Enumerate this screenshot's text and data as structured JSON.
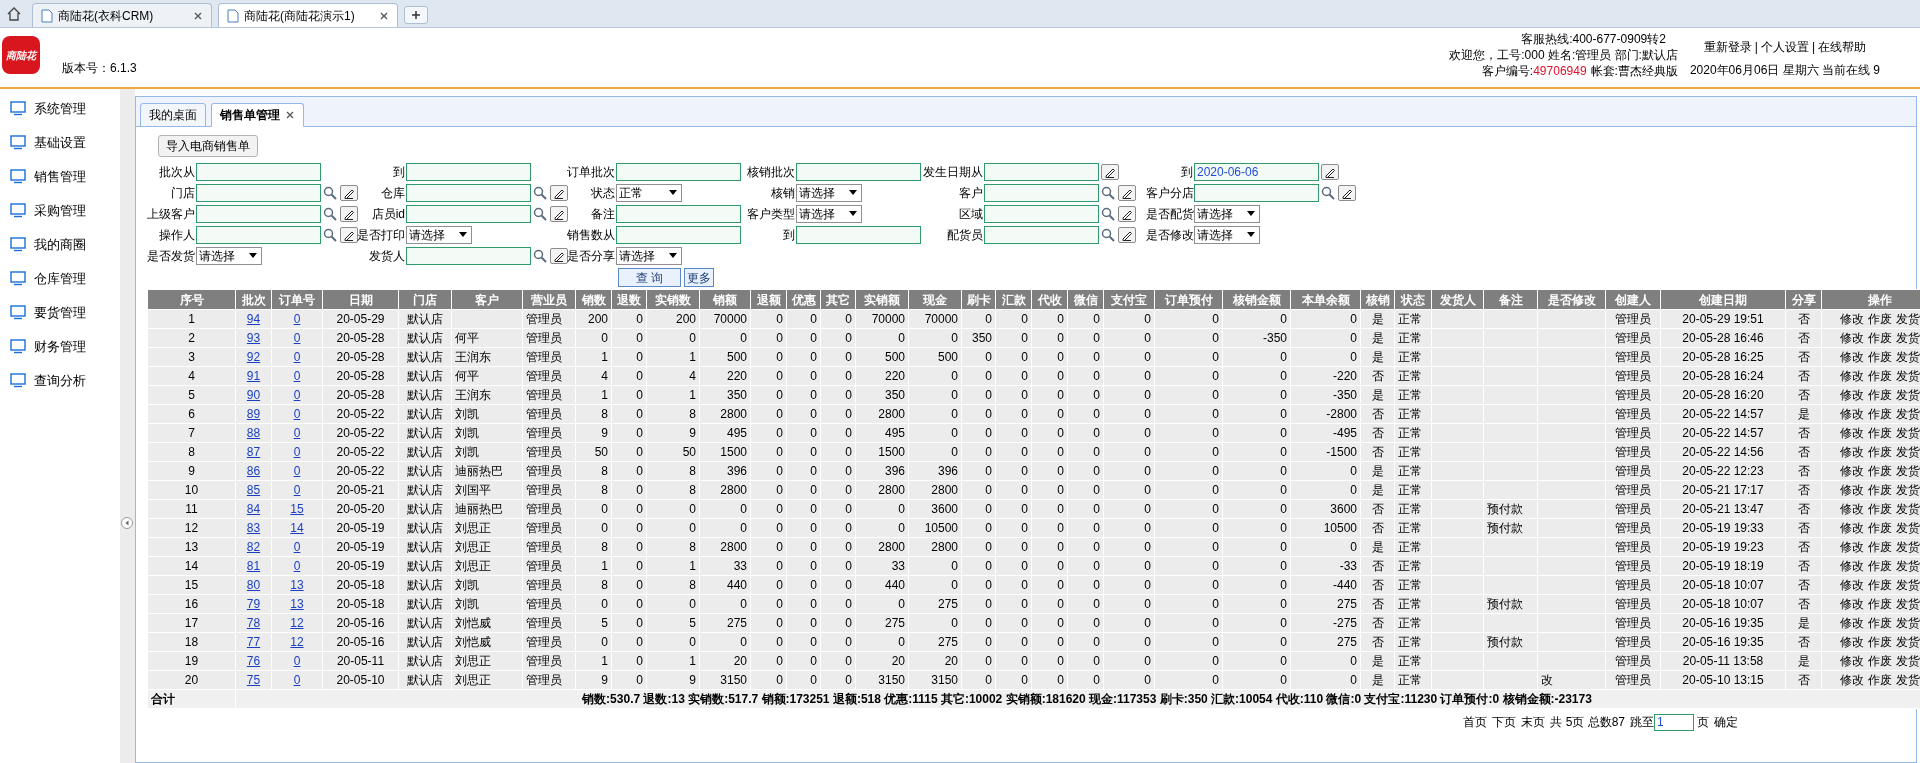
{
  "browser_tabs": [
    {
      "label": "商陆花(衣科CRM)",
      "selected": false
    },
    {
      "label": "商陆花(商陆花演示1)",
      "selected": true
    }
  ],
  "header": {
    "logo_text": "商陆花",
    "version": "版本号：6.1.3",
    "hotline": "客服热线:400-677-0909转2",
    "welcome": "欢迎您，工号:000 姓名:管理员 部门:默认店",
    "customer_label": "客户编号:",
    "customer_id": "49706949",
    "account": "帐套:曹杰经典版",
    "links": [
      "重新登录",
      "个人设置",
      "在线帮助"
    ],
    "link_separator": "|",
    "date_line": "2020年06月06日 星期六 当前在线 9"
  },
  "sidebar": {
    "items": [
      "系统管理",
      "基础设置",
      "销售管理",
      "采购管理",
      "我的商圈",
      "仓库管理",
      "要货管理",
      "财务管理",
      "查询分析"
    ]
  },
  "page_tabs": [
    {
      "label": "我的桌面",
      "selected": false,
      "closable": false
    },
    {
      "label": "销售单管理",
      "selected": true,
      "closable": true
    }
  ],
  "import_button": "导入电商销售单",
  "filters": [
    [
      {
        "label": "批次从",
        "kind": "text"
      },
      {
        "label": "到",
        "kind": "text"
      },
      {
        "label": "订单批次",
        "kind": "text"
      },
      {
        "label": "核销批次",
        "kind": "text"
      },
      {
        "label": "发生日期从",
        "kind": "date"
      },
      {
        "label": "到",
        "kind": "date",
        "value": "2020-06-06"
      }
    ],
    [
      {
        "label": "门店",
        "kind": "lookup"
      },
      {
        "label": "仓库",
        "kind": "lookup"
      },
      {
        "label": "状态",
        "kind": "select",
        "value": "正常"
      },
      {
        "label": "核销",
        "kind": "select",
        "value": "请选择"
      },
      {
        "label": "客户",
        "kind": "lookup"
      },
      {
        "label": "客户分店",
        "kind": "lookup"
      }
    ],
    [
      {
        "label": "上级客户",
        "kind": "lookup"
      },
      {
        "label": "店员id",
        "kind": "lookup"
      },
      {
        "label": "备注",
        "kind": "text"
      },
      {
        "label": "客户类型",
        "kind": "select",
        "value": "请选择"
      },
      {
        "label": "区域",
        "kind": "lookup"
      },
      {
        "label": "是否配货",
        "kind": "select",
        "value": "请选择"
      }
    ],
    [
      {
        "label": "操作人",
        "kind": "lookup"
      },
      {
        "label": "是否打印",
        "kind": "select",
        "value": "请选择"
      },
      {
        "label": "销售数从",
        "kind": "text"
      },
      {
        "label": "到",
        "kind": "text"
      },
      {
        "label": "配货员",
        "kind": "lookup"
      },
      {
        "label": "是否修改",
        "kind": "select",
        "value": "请选择"
      }
    ],
    [
      {
        "label": "是否发货",
        "kind": "select",
        "value": "请选择"
      },
      {
        "label": "发货人",
        "kind": "lookup"
      },
      {
        "label": "是否分享",
        "kind": "select",
        "value": "请选择"
      }
    ]
  ],
  "query_buttons": [
    "查 询",
    "更多"
  ],
  "table": {
    "columns": [
      "序号",
      "批次",
      "订单号",
      "日期",
      "门店",
      "客户",
      "营业员",
      "销数",
      "退数",
      "实销数",
      "销额",
      "退额",
      "优惠",
      "其它",
      "实销额",
      "现金",
      "刷卡",
      "汇款",
      "代收",
      "微信",
      "支付宝",
      "订单预付",
      "核销金额",
      "本单余额",
      "核销",
      "状态",
      "发货人",
      "备注",
      "是否修改",
      "创建人",
      "创建日期",
      "分享",
      "操作"
    ],
    "rows": [
      {
        "cells": [
          "1",
          "94",
          "0",
          "20-05-29",
          "默认店",
          null,
          "管理员",
          "200",
          "0",
          "200",
          "70000",
          "0",
          "0",
          "0",
          "70000",
          "70000",
          "0",
          "0",
          "0",
          "0",
          "0",
          "0",
          "0",
          "0",
          "是",
          "正常",
          null,
          null,
          null,
          "管理员",
          "20-05-29 19:51",
          "否"
        ],
        "actions": [
          "修改",
          "作废",
          "发货"
        ]
      },
      {
        "cells": [
          "2",
          "93",
          "0",
          "20-05-28",
          "默认店",
          "何平",
          "管理员",
          "0",
          "0",
          "0",
          "0",
          "0",
          "0",
          "0",
          "0",
          "0",
          "350",
          "0",
          "0",
          "0",
          "0",
          "0",
          "-350",
          "0",
          "是",
          "正常",
          null,
          null,
          null,
          "管理员",
          "20-05-28 16:46",
          "否"
        ],
        "actions": [
          "修改",
          "作废",
          "发货"
        ]
      },
      {
        "cells": [
          "3",
          "92",
          "0",
          "20-05-28",
          "默认店",
          "王润东",
          "管理员",
          "1",
          "0",
          "1",
          "500",
          "0",
          "0",
          "0",
          "500",
          "500",
          "0",
          "0",
          "0",
          "0",
          "0",
          "0",
          "0",
          "0",
          "是",
          "正常",
          null,
          null,
          null,
          "管理员",
          "20-05-28 16:25",
          "否"
        ],
        "actions": [
          "修改",
          "作废",
          "发货"
        ]
      },
      {
        "cells": [
          "4",
          "91",
          "0",
          "20-05-28",
          "默认店",
          "何平",
          "管理员",
          "4",
          "0",
          "4",
          "220",
          "0",
          "0",
          "0",
          "220",
          "0",
          "0",
          "0",
          "0",
          "0",
          "0",
          "0",
          "0",
          "-220",
          "否",
          "正常",
          null,
          null,
          null,
          "管理员",
          "20-05-28 16:24",
          "否"
        ],
        "actions": [
          "修改",
          "作废",
          "发货"
        ]
      },
      {
        "cells": [
          "5",
          "90",
          "0",
          "20-05-28",
          "默认店",
          "王润东",
          "管理员",
          "1",
          "0",
          "1",
          "350",
          "0",
          "0",
          "0",
          "350",
          "0",
          "0",
          "0",
          "0",
          "0",
          "0",
          "0",
          "0",
          "-350",
          "是",
          "正常",
          null,
          null,
          null,
          "管理员",
          "20-05-28 16:20",
          "否"
        ],
        "actions": [
          "修改",
          "作废",
          "发货"
        ]
      },
      {
        "cells": [
          "6",
          "89",
          "0",
          "20-05-22",
          "默认店",
          "刘凯",
          "管理员",
          "8",
          "0",
          "8",
          "2800",
          "0",
          "0",
          "0",
          "2800",
          "0",
          "0",
          "0",
          "0",
          "0",
          "0",
          "0",
          "0",
          "-2800",
          "否",
          "正常",
          null,
          null,
          null,
          "管理员",
          "20-05-22 14:57",
          "是"
        ],
        "actions": [
          "修改",
          "作废",
          "发货"
        ]
      },
      {
        "cells": [
          "7",
          "88",
          "0",
          "20-05-22",
          "默认店",
          "刘凯",
          "管理员",
          "9",
          "0",
          "9",
          "495",
          "0",
          "0",
          "0",
          "495",
          "0",
          "0",
          "0",
          "0",
          "0",
          "0",
          "0",
          "0",
          "-495",
          "否",
          "正常",
          null,
          null,
          null,
          "管理员",
          "20-05-22 14:57",
          "否"
        ],
        "actions": [
          "修改",
          "作废",
          "发货"
        ]
      },
      {
        "cells": [
          "8",
          "87",
          "0",
          "20-05-22",
          "默认店",
          "刘凯",
          "管理员",
          "50",
          "0",
          "50",
          "1500",
          "0",
          "0",
          "0",
          "1500",
          "0",
          "0",
          "0",
          "0",
          "0",
          "0",
          "0",
          "0",
          "-1500",
          "否",
          "正常",
          null,
          null,
          null,
          "管理员",
          "20-05-22 14:56",
          "否"
        ],
        "actions": [
          "修改",
          "作废",
          "发货"
        ]
      },
      {
        "cells": [
          "9",
          "86",
          "0",
          "20-05-22",
          "默认店",
          "迪丽热巴",
          "管理员",
          "8",
          "0",
          "8",
          "396",
          "0",
          "0",
          "0",
          "396",
          "396",
          "0",
          "0",
          "0",
          "0",
          "0",
          "0",
          "0",
          "0",
          "是",
          "正常",
          null,
          null,
          null,
          "管理员",
          "20-05-22 12:23",
          "否"
        ],
        "actions": [
          "修改",
          "作废",
          "发货"
        ]
      },
      {
        "cells": [
          "10",
          "85",
          "0",
          "20-05-21",
          "默认店",
          "刘国平",
          "管理员",
          "8",
          "0",
          "8",
          "2800",
          "0",
          "0",
          "0",
          "2800",
          "2800",
          "0",
          "0",
          "0",
          "0",
          "0",
          "0",
          "0",
          "0",
          "是",
          "正常",
          null,
          null,
          null,
          "管理员",
          "20-05-21 17:17",
          "否"
        ],
        "actions": [
          "修改",
          "作废",
          "发货"
        ]
      },
      {
        "cells": [
          "11",
          "84",
          "15",
          "20-05-20",
          "默认店",
          "迪丽热巴",
          "管理员",
          "0",
          "0",
          "0",
          "0",
          "0",
          "0",
          "0",
          "0",
          "3600",
          "0",
          "0",
          "0",
          "0",
          "0",
          "0",
          "0",
          "3600",
          "否",
          "正常",
          null,
          "预付款",
          null,
          "管理员",
          "20-05-21 13:47",
          "否"
        ],
        "actions": [
          "修改",
          "作废",
          "发货"
        ]
      },
      {
        "cells": [
          "12",
          "83",
          "14",
          "20-05-19",
          "默认店",
          "刘思正",
          "管理员",
          "0",
          "0",
          "0",
          "0",
          "0",
          "0",
          "0",
          "0",
          "10500",
          "0",
          "0",
          "0",
          "0",
          "0",
          "0",
          "0",
          "10500",
          "否",
          "正常",
          null,
          "预付款",
          null,
          "管理员",
          "20-05-19 19:33",
          "否"
        ],
        "actions": [
          "修改",
          "作废",
          "发货"
        ]
      },
      {
        "cells": [
          "13",
          "82",
          "0",
          "20-05-19",
          "默认店",
          "刘思正",
          "管理员",
          "8",
          "0",
          "8",
          "2800",
          "0",
          "0",
          "0",
          "2800",
          "2800",
          "0",
          "0",
          "0",
          "0",
          "0",
          "0",
          "0",
          "0",
          "是",
          "正常",
          null,
          null,
          null,
          "管理员",
          "20-05-19 19:23",
          "否"
        ],
        "actions": [
          "修改",
          "作废",
          "发货"
        ]
      },
      {
        "cells": [
          "14",
          "81",
          "0",
          "20-05-19",
          "默认店",
          "刘思正",
          "管理员",
          "1",
          "0",
          "1",
          "33",
          "0",
          "0",
          "0",
          "33",
          "0",
          "0",
          "0",
          "0",
          "0",
          "0",
          "0",
          "0",
          "-33",
          "否",
          "正常",
          null,
          null,
          null,
          "管理员",
          "20-05-19 18:19",
          "否"
        ],
        "actions": [
          "修改",
          "作废",
          "发货"
        ]
      },
      {
        "cells": [
          "15",
          "80",
          "13",
          "20-05-18",
          "默认店",
          "刘凯",
          "管理员",
          "8",
          "0",
          "8",
          "440",
          "0",
          "0",
          "0",
          "440",
          "0",
          "0",
          "0",
          "0",
          "0",
          "0",
          "0",
          "0",
          "-440",
          "否",
          "正常",
          null,
          null,
          null,
          "管理员",
          "20-05-18 10:07",
          "否"
        ],
        "actions": [
          "修改",
          "作废",
          "发货"
        ]
      },
      {
        "cells": [
          "16",
          "79",
          "13",
          "20-05-18",
          "默认店",
          "刘凯",
          "管理员",
          "0",
          "0",
          "0",
          "0",
          "0",
          "0",
          "0",
          "0",
          "275",
          "0",
          "0",
          "0",
          "0",
          "0",
          "0",
          "0",
          "275",
          "否",
          "正常",
          null,
          "预付款",
          null,
          "管理员",
          "20-05-18 10:07",
          "否"
        ],
        "actions": [
          "修改",
          "作废",
          "发货"
        ]
      },
      {
        "cells": [
          "17",
          "78",
          "12",
          "20-05-16",
          "默认店",
          "刘恺威",
          "管理员",
          "5",
          "0",
          "5",
          "275",
          "0",
          "0",
          "0",
          "275",
          "0",
          "0",
          "0",
          "0",
          "0",
          "0",
          "0",
          "0",
          "-275",
          "否",
          "正常",
          null,
          null,
          null,
          "管理员",
          "20-05-16 19:35",
          "是"
        ],
        "actions": [
          "修改",
          "作废",
          "发货"
        ]
      },
      {
        "cells": [
          "18",
          "77",
          "12",
          "20-05-16",
          "默认店",
          "刘恺威",
          "管理员",
          "0",
          "0",
          "0",
          "0",
          "0",
          "0",
          "0",
          "0",
          "275",
          "0",
          "0",
          "0",
          "0",
          "0",
          "0",
          "0",
          "275",
          "否",
          "正常",
          null,
          "预付款",
          null,
          "管理员",
          "20-05-16 19:35",
          "否"
        ],
        "actions": [
          "修改",
          "作废",
          "发货"
        ]
      },
      {
        "cells": [
          "19",
          "76",
          "0",
          "20-05-11",
          "默认店",
          "刘思正",
          "管理员",
          "1",
          "0",
          "1",
          "20",
          "0",
          "0",
          "0",
          "20",
          "20",
          "0",
          "0",
          "0",
          "0",
          "0",
          "0",
          "0",
          "0",
          "是",
          "正常",
          null,
          null,
          null,
          "管理员",
          "20-05-11 13:58",
          "是"
        ],
        "actions": [
          "修改",
          "作废",
          "发货"
        ]
      },
      {
        "cells": [
          "20",
          "75",
          "0",
          "20-05-10",
          "默认店",
          "刘思正",
          "管理员",
          "9",
          "0",
          "9",
          "3150",
          "0",
          "0",
          "0",
          "3150",
          "3150",
          "0",
          "0",
          "0",
          "0",
          "0",
          "0",
          "0",
          "0",
          "是",
          "正常",
          null,
          null,
          "改",
          "管理员",
          "20-05-10 13:15",
          "否"
        ],
        "actions": [
          "修改",
          "作废",
          "发货"
        ]
      }
    ],
    "total": {
      "label": "合计",
      "summary": "销数:530.7 退数:13 实销数:517.7 销额:173251 退额:518 优惠:1115 其它:10002 实销额:181620 现金:117353 刷卡:350 汇款:10054 代收:110 微信:0 支付宝:11230 订单预付:0 核销金额:-23173"
    }
  },
  "pagination": {
    "links": [
      "首页",
      "下页",
      "末页"
    ],
    "info": "共 5页 总数87",
    "jump_label": "跳至",
    "page_value": "1",
    "page_unit": "页",
    "confirm": "确定"
  }
}
